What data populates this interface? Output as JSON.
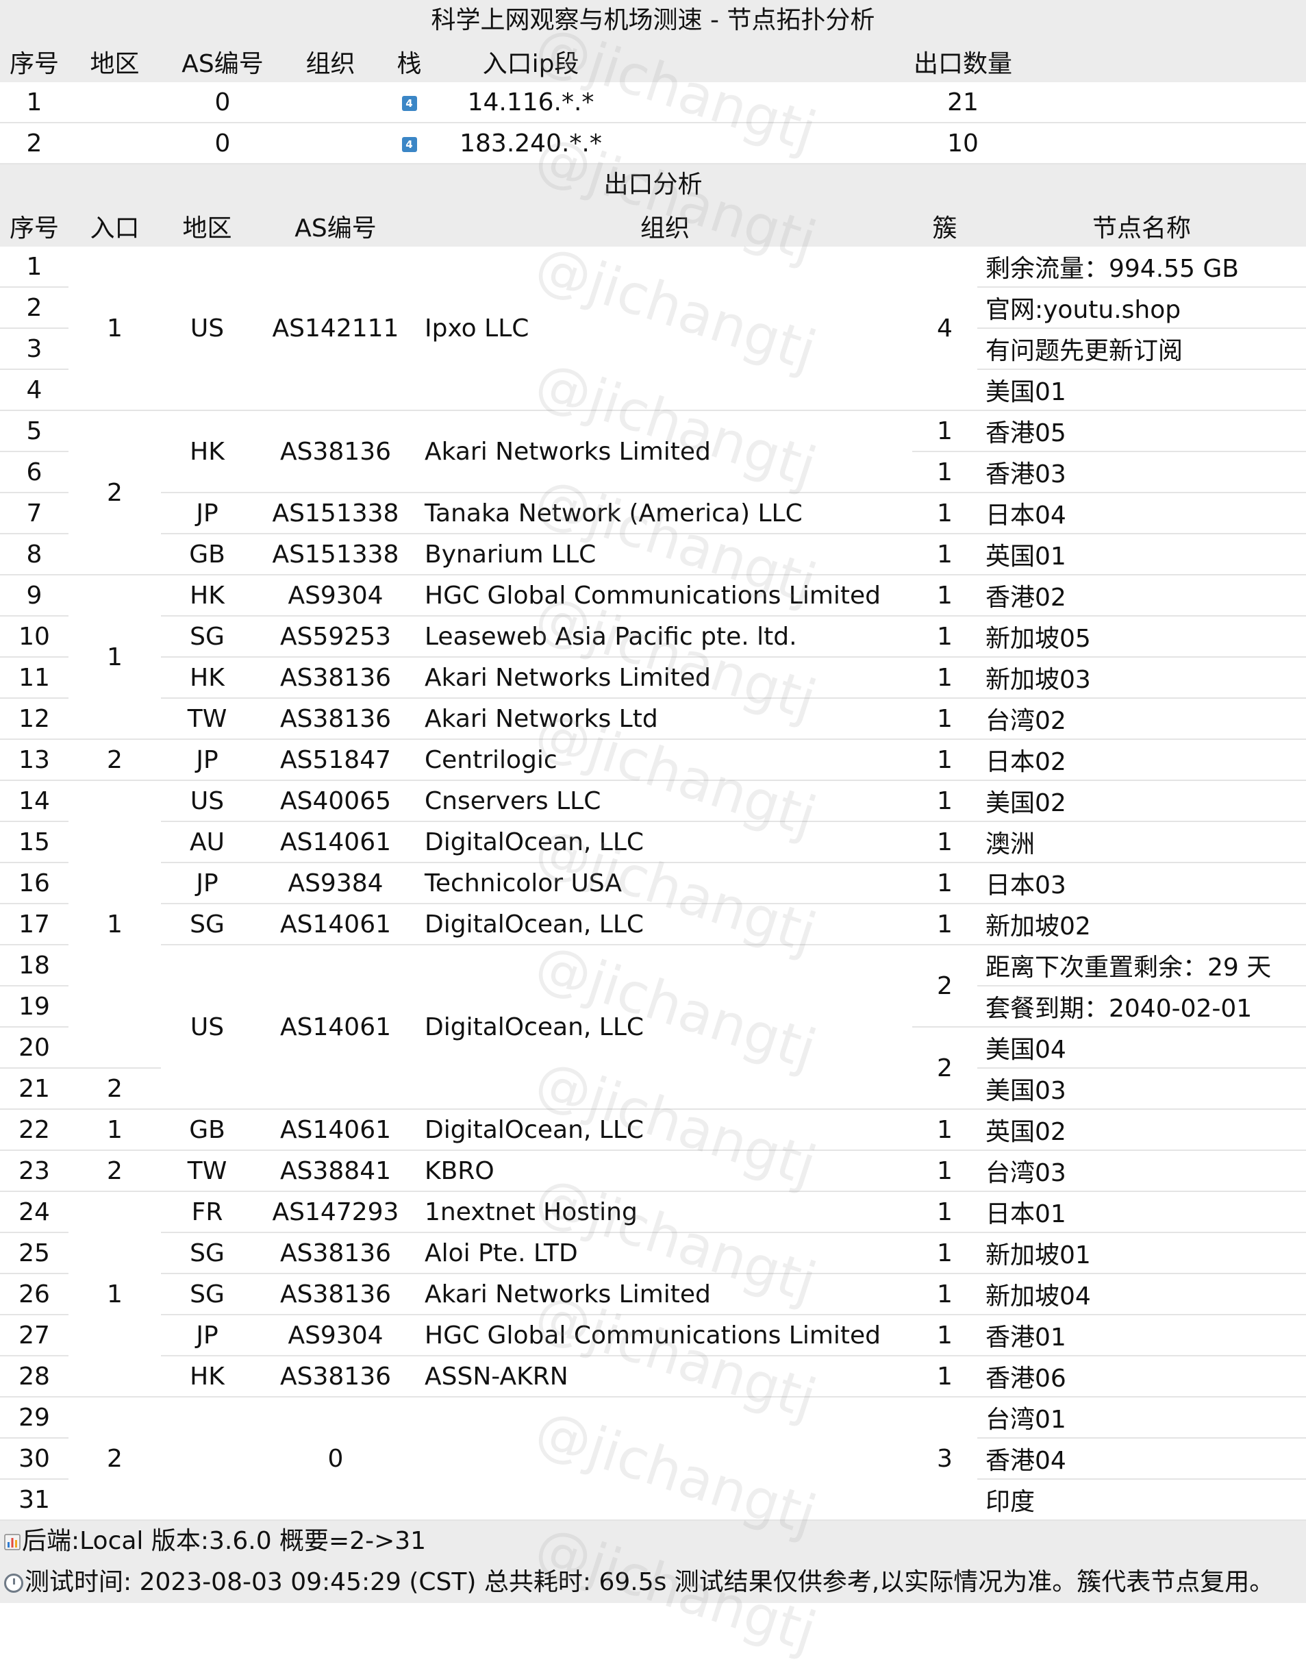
{
  "title": "科学上网观察与机场测速 - 节点拓扑分析",
  "entry_table": {
    "headers": [
      "序号",
      "地区",
      "AS编号",
      "组织",
      "栈",
      "入口ip段",
      "出口数量"
    ],
    "rows": [
      {
        "id": "1",
        "region": "",
        "as": "0",
        "org": "",
        "stack": "4",
        "ip": "14.116.*.*",
        "count": "21"
      },
      {
        "id": "2",
        "region": "",
        "as": "0",
        "org": "",
        "stack": "4",
        "ip": "183.240.*.*",
        "count": "10"
      }
    ]
  },
  "exit_section_title": "出口分析",
  "exit_table": {
    "headers": [
      "序号",
      "入口",
      "地区",
      "AS编号",
      "组织",
      "簇",
      "节点名称"
    ],
    "seq": [
      "1",
      "2",
      "3",
      "4",
      "5",
      "6",
      "7",
      "8",
      "9",
      "10",
      "11",
      "12",
      "13",
      "14",
      "15",
      "16",
      "17",
      "18",
      "19",
      "20",
      "21",
      "22",
      "23",
      "24",
      "25",
      "26",
      "27",
      "28",
      "29",
      "30",
      "31"
    ],
    "entry_groups": [
      {
        "value": "1",
        "rows": 4
      },
      {
        "value": "2",
        "rows": 4
      },
      {
        "value": "1",
        "rows": 4
      },
      {
        "value": "2",
        "rows": 1
      },
      {
        "value": "1",
        "rows": 7
      },
      {
        "value": "2",
        "rows": 1
      },
      {
        "value": "1",
        "rows": 1
      },
      {
        "value": "2",
        "rows": 1
      },
      {
        "value": "1",
        "rows": 5
      },
      {
        "value": "2",
        "rows": 3
      }
    ],
    "exit_groups": [
      {
        "region": "US",
        "as": "AS142111",
        "org": "Ipxo LLC",
        "rows": 4
      },
      {
        "region": "HK",
        "as": "AS38136",
        "org": "Akari Networks Limited",
        "rows": 2
      },
      {
        "region": "JP",
        "as": "AS151338",
        "org": "Tanaka Network (America) LLC",
        "rows": 1
      },
      {
        "region": "GB",
        "as": "AS151338",
        "org": "Bynarium LLC",
        "rows": 1
      },
      {
        "region": "HK",
        "as": "AS9304",
        "org": "HGC Global Communications Limited",
        "rows": 1
      },
      {
        "region": "SG",
        "as": "AS59253",
        "org": "Leaseweb Asia Pacific pte. ltd.",
        "rows": 1
      },
      {
        "region": "HK",
        "as": "AS38136",
        "org": "Akari Networks Limited",
        "rows": 1
      },
      {
        "region": "TW",
        "as": "AS38136",
        "org": "Akari Networks Ltd",
        "rows": 1
      },
      {
        "region": "JP",
        "as": "AS51847",
        "org": "Centrilogic",
        "rows": 1
      },
      {
        "region": "US",
        "as": "AS40065",
        "org": "Cnservers LLC",
        "rows": 1
      },
      {
        "region": "AU",
        "as": "AS14061",
        "org": "DigitalOcean, LLC",
        "rows": 1
      },
      {
        "region": "JP",
        "as": "AS9384",
        "org": "Technicolor USA",
        "rows": 1
      },
      {
        "region": "SG",
        "as": "AS14061",
        "org": "DigitalOcean, LLC",
        "rows": 1
      },
      {
        "region": "US",
        "as": "AS14061",
        "org": "DigitalOcean, LLC",
        "rows": 4
      },
      {
        "region": "GB",
        "as": "AS14061",
        "org": "DigitalOcean, LLC",
        "rows": 1
      },
      {
        "region": "TW",
        "as": "AS38841",
        "org": "KBRO",
        "rows": 1
      },
      {
        "region": "FR",
        "as": "AS147293",
        "org": "1nextnet Hosting",
        "rows": 1
      },
      {
        "region": "SG",
        "as": "AS38136",
        "org": "Aloi Pte. LTD",
        "rows": 1
      },
      {
        "region": "SG",
        "as": "AS38136",
        "org": "Akari Networks Limited",
        "rows": 1
      },
      {
        "region": "JP",
        "as": "AS9304",
        "org": "HGC Global Communications Limited",
        "rows": 1
      },
      {
        "region": "HK",
        "as": "AS38136",
        "org": "ASSN-AKRN",
        "rows": 1
      },
      {
        "region": "",
        "as": "0",
        "org": "",
        "rows": 3
      }
    ],
    "clusters": [
      {
        "value": "4",
        "rows": 4
      },
      {
        "value": "1",
        "rows": 1
      },
      {
        "value": "1",
        "rows": 1
      },
      {
        "value": "1",
        "rows": 1
      },
      {
        "value": "1",
        "rows": 1
      },
      {
        "value": "1",
        "rows": 1
      },
      {
        "value": "1",
        "rows": 1
      },
      {
        "value": "1",
        "rows": 1
      },
      {
        "value": "1",
        "rows": 1
      },
      {
        "value": "1",
        "rows": 1
      },
      {
        "value": "1",
        "rows": 1
      },
      {
        "value": "1",
        "rows": 1
      },
      {
        "value": "1",
        "rows": 1
      },
      {
        "value": "1",
        "rows": 1
      },
      {
        "value": "2",
        "rows": 2
      },
      {
        "value": "2",
        "rows": 2
      },
      {
        "value": "1",
        "rows": 1
      },
      {
        "value": "1",
        "rows": 1
      },
      {
        "value": "1",
        "rows": 1
      },
      {
        "value": "1",
        "rows": 1
      },
      {
        "value": "1",
        "rows": 1
      },
      {
        "value": "1",
        "rows": 1
      },
      {
        "value": "1",
        "rows": 1
      },
      {
        "value": "3",
        "rows": 3
      }
    ],
    "node_names": [
      "剩余流量：994.55 GB",
      "官网:youtu.shop",
      "有问题先更新订阅",
      "美国01",
      "香港05",
      "香港03",
      "日本04",
      "英国01",
      "香港02",
      "新加坡05",
      "新加坡03",
      "台湾02",
      "日本02",
      "美国02",
      "澳洲",
      "日本03",
      "新加坡02",
      "距离下次重置剩余：29 天",
      "套餐到期：2040-02-01",
      "美国04",
      "美国03",
      "英国02",
      "台湾03",
      "日本01",
      "新加坡01",
      "新加坡04",
      "香港01",
      "香港06",
      "台湾01",
      "香港04",
      "印度"
    ]
  },
  "footer": {
    "line1": "后端:Local 版本:3.6.0  概要=2->31",
    "line2": "测试时间: 2023-08-03 09:45:29 (CST) 总共耗时: 69.5s 测试结果仅供参考,以实际情况为准。簇代表节点复用。",
    "chart_icon": "bar-chart-icon",
    "clock_icon": "clock-icon"
  },
  "watermark": "@jichangtj",
  "colors": {
    "header_bg": "#ececec",
    "stack_badge": "#3b86c6",
    "row_border": "#e4e4e4"
  }
}
